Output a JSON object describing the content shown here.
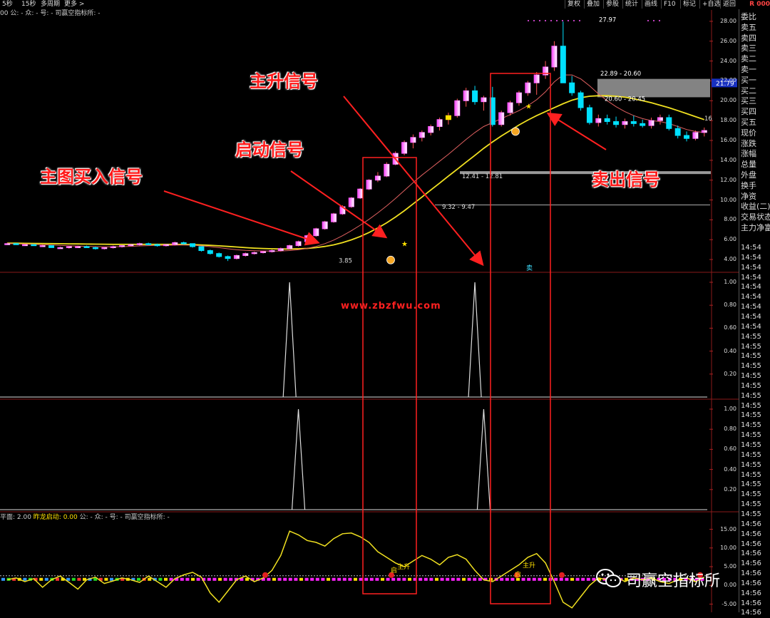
{
  "toolbar": {
    "left_items": [
      "5秒",
      "15秒",
      "多周期",
      "更多 >"
    ],
    "right_buttons": [
      "复权",
      "叠加",
      "参股",
      "统计",
      "画线",
      "F10",
      "标记",
      "+自选",
      "返回"
    ],
    "corner_badge": "R 000"
  },
  "info_line": "00 公: - 众: - 号: - 司赢空指标所: -",
  "bottom_info": {
    "prefix": "平面: 2.00 ",
    "highlight": "昨龙启动: 0.00",
    "suffix": " 公: - 众: - 号: - 司赢空指标所: -"
  },
  "right_panel": {
    "labels": [
      "委比",
      "卖五",
      "卖四",
      "卖三",
      "卖二",
      "卖一",
      "买一",
      "买二",
      "买三",
      "买四",
      "买五",
      "现价",
      "涨跌",
      "涨幅",
      "总量",
      "外盘",
      "换手",
      "净资",
      "收益(二)",
      "交易状态",
      "主力净富"
    ],
    "times": [
      "14:54",
      "14:54",
      "14:54",
      "14:54",
      "14:54",
      "14:54",
      "14:54",
      "14:54",
      "14:54",
      "14:55",
      "14:55",
      "14:55",
      "14:55",
      "14:55",
      "14:55",
      "14:55",
      "14:55",
      "14:55",
      "14:55",
      "14:55",
      "14:55",
      "14:55",
      "14:55",
      "14:55",
      "14:55",
      "14:55",
      "14:55",
      "14:55",
      "14:56",
      "14:56",
      "14:56",
      "14:56",
      "14:56",
      "14:56",
      "14:56",
      "14:56",
      "14:56",
      "14:56"
    ]
  },
  "annotations": {
    "main_buy": "主图买入信号",
    "start": "启动信号",
    "main_rise": "主升信号",
    "sell": "卖出信号"
  },
  "watermark": "www.zbzfwu.com",
  "brand": "司赢空指标所",
  "chart_data": [
    {
      "type": "candlestick",
      "name": "main",
      "y_ticks": [
        "28.00",
        "26.00",
        "24.00",
        "22.00",
        "20.00",
        "18.00",
        "16.00",
        "14.00",
        "12.00",
        "10.00",
        "8.00",
        "6.00",
        "4.00"
      ],
      "ylim": [
        3.0,
        29.0
      ],
      "current_price_tag": "21.79",
      "price_labels": [
        "27.97",
        "22.89 - 20.60",
        "20.60 - 20.45",
        "12.41 - 12.81",
        "9.32 - 9.47",
        "3.85",
        "16"
      ],
      "markers": [
        "启动",
        "主升",
        "卖"
      ],
      "candles": [
        [
          5.6,
          5.7,
          5.5,
          5.6
        ],
        [
          5.6,
          5.6,
          5.5,
          5.5
        ],
        [
          5.5,
          5.6,
          5.4,
          5.5
        ],
        [
          5.5,
          5.5,
          5.4,
          5.4
        ],
        [
          5.4,
          5.5,
          5.3,
          5.4
        ],
        [
          5.4,
          5.4,
          5.2,
          5.2
        ],
        [
          5.2,
          5.3,
          5.1,
          5.2
        ],
        [
          5.2,
          5.3,
          5.1,
          5.3
        ],
        [
          5.3,
          5.4,
          5.2,
          5.3
        ],
        [
          5.3,
          5.4,
          5.2,
          5.2
        ],
        [
          5.2,
          5.3,
          5.0,
          5.1
        ],
        [
          5.1,
          5.2,
          5.0,
          5.2
        ],
        [
          5.2,
          5.4,
          5.1,
          5.3
        ],
        [
          5.3,
          5.4,
          5.2,
          5.4
        ],
        [
          5.4,
          5.5,
          5.3,
          5.5
        ],
        [
          5.5,
          5.7,
          5.4,
          5.6
        ],
        [
          5.6,
          5.7,
          5.5,
          5.5
        ],
        [
          5.5,
          5.6,
          5.3,
          5.4
        ],
        [
          5.4,
          5.5,
          5.3,
          5.5
        ],
        [
          5.5,
          5.8,
          5.4,
          5.7
        ],
        [
          5.7,
          5.8,
          5.5,
          5.6
        ],
        [
          5.6,
          5.6,
          5.2,
          5.3
        ],
        [
          5.3,
          5.3,
          4.8,
          4.9
        ],
        [
          4.9,
          5.0,
          4.5,
          4.6
        ],
        [
          4.6,
          4.7,
          4.2,
          4.3
        ],
        [
          4.3,
          4.4,
          3.85,
          4.1
        ],
        [
          4.1,
          4.5,
          4.0,
          4.4
        ],
        [
          4.4,
          4.7,
          4.3,
          4.6
        ],
        [
          4.6,
          4.8,
          4.5,
          4.7
        ],
        [
          4.7,
          4.9,
          4.6,
          4.8
        ],
        [
          4.8,
          5.0,
          4.7,
          4.9
        ],
        [
          4.9,
          5.2,
          4.8,
          5.1
        ],
        [
          5.1,
          5.5,
          5.0,
          5.4
        ],
        [
          5.4,
          5.9,
          5.3,
          5.8
        ],
        [
          5.8,
          6.5,
          5.7,
          6.4
        ],
        [
          6.4,
          7.2,
          6.3,
          7.1
        ],
        [
          7.1,
          7.9,
          7.0,
          7.8
        ],
        [
          7.8,
          8.7,
          7.7,
          8.6
        ],
        [
          8.6,
          9.47,
          8.5,
          9.32
        ],
        [
          9.32,
          10.3,
          9.2,
          10.2
        ],
        [
          10.2,
          11.2,
          10.1,
          11.1
        ],
        [
          11.1,
          12.1,
          11.0,
          12.0
        ],
        [
          12.0,
          12.81,
          11.8,
          12.41
        ],
        [
          12.41,
          13.8,
          12.3,
          13.6
        ],
        [
          13.6,
          14.9,
          13.5,
          14.7
        ],
        [
          14.7,
          16.0,
          14.5,
          15.8
        ],
        [
          15.8,
          16.6,
          15.2,
          16.3
        ],
        [
          16.3,
          17.0,
          15.9,
          16.8
        ],
        [
          16.8,
          17.6,
          16.5,
          17.4
        ],
        [
          17.4,
          18.3,
          17.0,
          18.1
        ],
        [
          18.1,
          18.8,
          17.6,
          18.5
        ],
        [
          18.5,
          20.2,
          18.3,
          20.0
        ],
        [
          20.0,
          21.3,
          19.4,
          21.0
        ],
        [
          21.0,
          21.5,
          19.6,
          19.9
        ],
        [
          19.9,
          20.5,
          19.0,
          20.3
        ],
        [
          20.3,
          21.4,
          17.4,
          17.6
        ],
        [
          17.6,
          19.0,
          17.4,
          18.8
        ],
        [
          18.8,
          20.0,
          18.5,
          19.8
        ],
        [
          19.8,
          21.0,
          19.5,
          20.8
        ],
        [
          20.8,
          22.0,
          20.5,
          21.8
        ],
        [
          21.8,
          22.89,
          20.6,
          22.6
        ],
        [
          22.6,
          24.0,
          22.2,
          23.4
        ],
        [
          23.4,
          26.0,
          23.0,
          25.5
        ],
        [
          25.5,
          27.97,
          21.8,
          21.8
        ],
        [
          21.8,
          22.5,
          20.5,
          20.8
        ],
        [
          20.8,
          21.0,
          19.0,
          19.3
        ],
        [
          19.3,
          19.6,
          17.6,
          17.8
        ],
        [
          17.8,
          18.6,
          17.4,
          18.2
        ],
        [
          18.2,
          18.6,
          17.6,
          17.9
        ],
        [
          17.9,
          18.4,
          17.3,
          17.6
        ],
        [
          17.6,
          18.2,
          17.2,
          17.9
        ],
        [
          17.9,
          18.5,
          17.4,
          17.7
        ],
        [
          17.7,
          18.1,
          17.3,
          17.5
        ],
        [
          17.5,
          18.3,
          17.2,
          18.0
        ],
        [
          18.0,
          18.6,
          17.6,
          18.3
        ],
        [
          18.3,
          18.6,
          17.0,
          17.2
        ],
        [
          17.2,
          17.5,
          16.2,
          16.5
        ],
        [
          16.5,
          16.9,
          15.9,
          16.2
        ],
        [
          16.2,
          17.0,
          16.0,
          16.8
        ],
        [
          16.8,
          17.3,
          16.4,
          17.0
        ]
      ],
      "ma_white": [
        5.6,
        5.58,
        5.55,
        5.52,
        5.5,
        5.46,
        5.42,
        5.38,
        5.35,
        5.33,
        5.3,
        5.28,
        5.28,
        5.3,
        5.33,
        5.37,
        5.4,
        5.42,
        5.43,
        5.45,
        5.46,
        5.44,
        5.38,
        5.3,
        5.2,
        5.08,
        4.98,
        4.92,
        4.88,
        4.86,
        4.85,
        4.86,
        4.9,
        4.98,
        5.12,
        5.32,
        5.6,
        5.96,
        6.4,
        6.9,
        7.45,
        8.05,
        8.7,
        9.4,
        10.15,
        10.95,
        11.75,
        12.5,
        13.2,
        13.9,
        14.6,
        15.35,
        16.1,
        16.8,
        17.4,
        17.8,
        18.2,
        18.6,
        19.0,
        19.5,
        20.1,
        20.9,
        21.9,
        22.6,
        22.6,
        22.2,
        21.5,
        20.7,
        20.0,
        19.4,
        18.9,
        18.5,
        18.2,
        18.0,
        17.9,
        17.7,
        17.4,
        17.1,
        16.9,
        16.8
      ],
      "ma_yellow": [
        5.65,
        5.64,
        5.63,
        5.62,
        5.61,
        5.6,
        5.59,
        5.58,
        5.57,
        5.56,
        5.55,
        5.54,
        5.53,
        5.53,
        5.53,
        5.53,
        5.53,
        5.53,
        5.53,
        5.53,
        5.52,
        5.5,
        5.47,
        5.43,
        5.38,
        5.32,
        5.26,
        5.2,
        5.15,
        5.11,
        5.08,
        5.06,
        5.06,
        5.08,
        5.12,
        5.2,
        5.32,
        5.48,
        5.7,
        5.98,
        6.32,
        6.72,
        7.18,
        7.7,
        8.28,
        8.92,
        9.6,
        10.3,
        11.0,
        11.7,
        12.4,
        13.1,
        13.8,
        14.5,
        15.2,
        15.85,
        16.45,
        17.0,
        17.55,
        18.05,
        18.5,
        18.9,
        19.3,
        19.7,
        20.05,
        20.3,
        20.45,
        20.5,
        20.5,
        20.45,
        20.35,
        20.2,
        20.0,
        19.8,
        19.55,
        19.3,
        19.0,
        18.7,
        18.4,
        18.1
      ]
    },
    {
      "type": "line",
      "name": "signal_panel_1",
      "y_ticks": [
        "1.00",
        "0.80",
        "0.60",
        "0.40",
        "0.20"
      ],
      "ylim": [
        0,
        1.0
      ],
      "spikes": [
        {
          "index": 32,
          "value": 1.0
        },
        {
          "index": 53,
          "value": 1.0
        }
      ]
    },
    {
      "type": "line",
      "name": "signal_panel_2",
      "y_ticks": [
        "1.00",
        "0.80",
        "0.60",
        "0.40",
        "0.20"
      ],
      "ylim": [
        0,
        1.0
      ],
      "spikes": [
        {
          "index": 33,
          "value": 1.0
        },
        {
          "index": 54,
          "value": 1.0
        }
      ]
    },
    {
      "type": "line",
      "name": "oscillator",
      "y_ticks": [
        "15.00",
        "10.00",
        "5.00",
        "0.00",
        "-5.00"
      ],
      "ylim": [
        -7,
        17
      ],
      "baseline": 2.0,
      "values": [
        1.5,
        2.0,
        1.0,
        1.8,
        -0.5,
        1.5,
        2.5,
        0.8,
        -1.0,
        1.5,
        2.2,
        0.5,
        1.2,
        2.0,
        1.5,
        0.8,
        2.5,
        1.0,
        -0.5,
        1.8,
        2.8,
        3.5,
        2.2,
        -2.0,
        -4.5,
        -1.5,
        1.5,
        2.5,
        1.0,
        2.0,
        4.0,
        8.0,
        14.5,
        13.5,
        12.0,
        11.5,
        10.5,
        12.5,
        13.8,
        14.0,
        13.0,
        11.5,
        9.0,
        7.5,
        6.0,
        5.0,
        6.5,
        8.0,
        7.0,
        5.5,
        7.5,
        8.2,
        7.0,
        4.0,
        1.5,
        1.0,
        2.5,
        4.0,
        5.5,
        7.5,
        8.5,
        6.0,
        1.0,
        -4.5,
        -6.0,
        -3.0,
        0.0,
        2.0,
        1.5,
        2.5,
        1.0,
        2.0,
        1.5,
        2.0,
        1.0,
        0.5,
        1.5,
        2.0,
        1.0,
        2.2
      ],
      "labels": [
        "启",
        "主升",
        "启",
        "主升"
      ]
    }
  ]
}
